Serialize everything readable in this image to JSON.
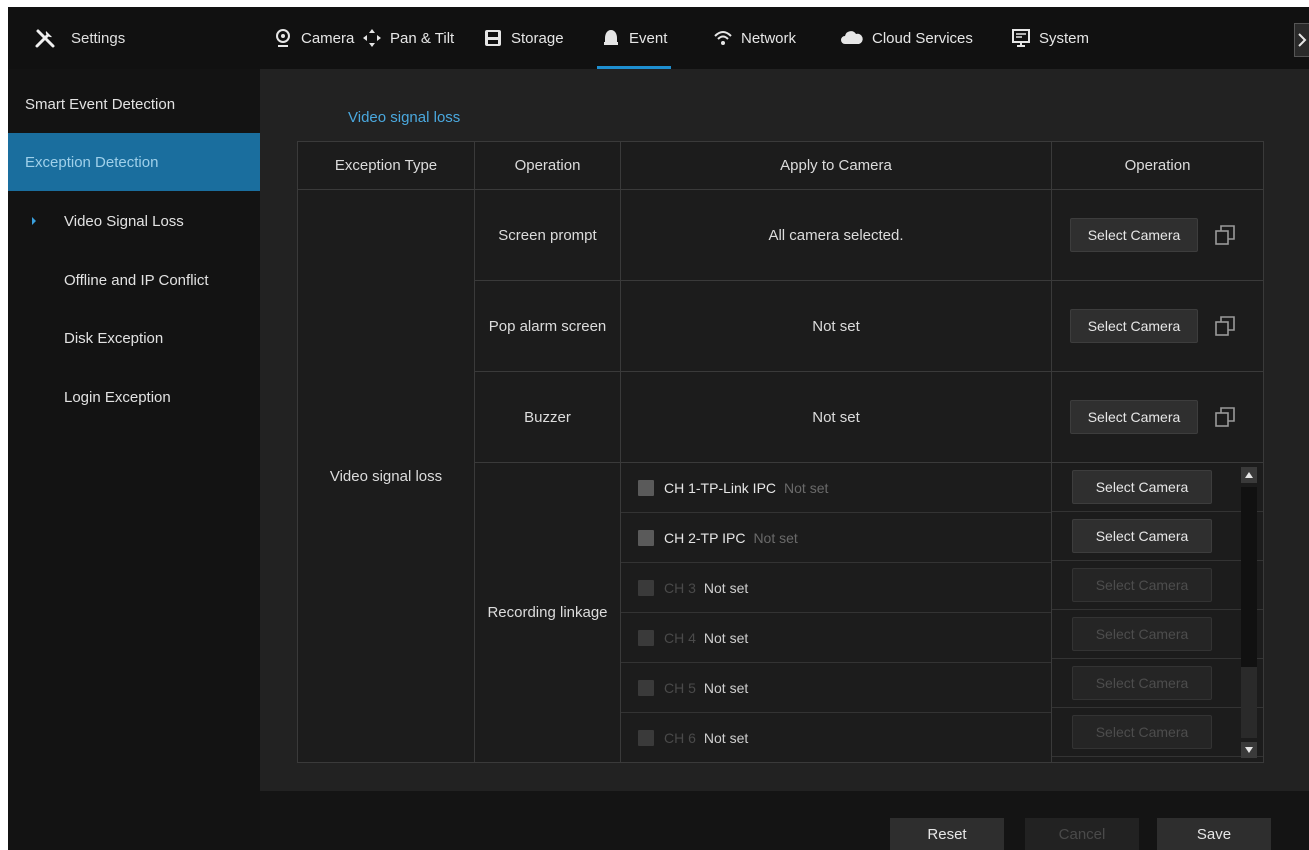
{
  "header": {
    "settings_label": "Settings",
    "tabs": [
      {
        "label": "Camera",
        "icon": "camera-icon"
      },
      {
        "label": "Pan & Tilt",
        "icon": "pan-tilt-icon"
      },
      {
        "label": "Storage",
        "icon": "storage-icon"
      },
      {
        "label": "Event",
        "icon": "bell-icon",
        "active": true
      },
      {
        "label": "Network",
        "icon": "wifi-icon"
      },
      {
        "label": "Cloud Services",
        "icon": "cloud-icon"
      },
      {
        "label": "System",
        "icon": "monitor-icon"
      }
    ],
    "accent_color": "#1e8fd0"
  },
  "sidebar": {
    "items": [
      {
        "label": "Smart Event Detection"
      },
      {
        "label": "Exception Detection",
        "active": true
      },
      {
        "label": "Video Signal Loss",
        "current": true
      },
      {
        "label": "Offline and IP Conflict"
      },
      {
        "label": "Disk Exception"
      },
      {
        "label": "Login Exception"
      }
    ]
  },
  "main": {
    "section_title": "Video signal loss",
    "table": {
      "headers": [
        "Exception Type",
        "Operation",
        "Apply to Camera",
        "Operation"
      ],
      "exception_type": "Video signal loss",
      "rows": [
        {
          "operation": "Screen prompt",
          "apply": "All camera selected.",
          "button": "Select Camera"
        },
        {
          "operation": "Pop alarm screen",
          "apply": "Not set",
          "button": "Select Camera"
        },
        {
          "operation": "Buzzer",
          "apply": "Not set",
          "button": "Select Camera"
        }
      ],
      "recording": {
        "operation": "Recording linkage",
        "channels": [
          {
            "name": "CH 1-TP-Link IPC",
            "status": "Not set",
            "button": "Select Camera",
            "enabled": true
          },
          {
            "name": "CH 2-TP IPC",
            "status": "Not set",
            "button": "Select Camera",
            "enabled": true
          },
          {
            "name": "CH 3",
            "status": "Not set",
            "button": "Select Camera",
            "enabled": false
          },
          {
            "name": "CH 4",
            "status": "Not set",
            "button": "Select Camera",
            "enabled": false
          },
          {
            "name": "CH 5",
            "status": "Not set",
            "button": "Select Camera",
            "enabled": false
          },
          {
            "name": "CH 6",
            "status": "Not set",
            "button": "Select Camera",
            "enabled": false
          }
        ]
      }
    }
  },
  "footer": {
    "reset_label": "Reset",
    "cancel_label": "Cancel",
    "save_label": "Save"
  }
}
